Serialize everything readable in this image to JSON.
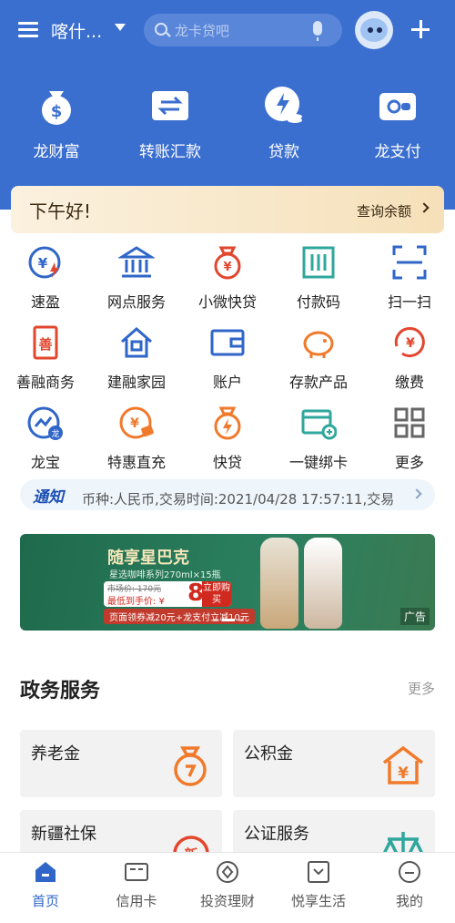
{
  "header": {
    "city": "喀什...",
    "search_placeholder": "龙卡贷吧"
  },
  "quick_actions": [
    {
      "label": "龙财富",
      "icon": "money-bag-icon"
    },
    {
      "label": "转账汇款",
      "icon": "transfer-icon"
    },
    {
      "label": "贷款",
      "icon": "loan-icon"
    },
    {
      "label": "龙支付",
      "icon": "wallet-icon"
    }
  ],
  "greeting": {
    "text": "下午好!",
    "balance_link": "查询余额"
  },
  "services": [
    {
      "label": "速盈",
      "icon": "yen-lightning-icon"
    },
    {
      "label": "网点服务",
      "icon": "bank-building-icon"
    },
    {
      "label": "小微快贷",
      "icon": "yen-bag-icon"
    },
    {
      "label": "付款码",
      "icon": "barcode-icon"
    },
    {
      "label": "扫一扫",
      "icon": "scan-icon"
    },
    {
      "label": "善融商务",
      "icon": "shan-icon"
    },
    {
      "label": "建融家园",
      "icon": "house-icon"
    },
    {
      "label": "账户",
      "icon": "wallet-account-icon"
    },
    {
      "label": "存款产品",
      "icon": "piggy-bank-icon"
    },
    {
      "label": "缴费",
      "icon": "yen-clock-icon"
    },
    {
      "label": "龙宝",
      "icon": "dragon-treasure-icon"
    },
    {
      "label": "特惠直充",
      "icon": "yen-tag-icon"
    },
    {
      "label": "快贷",
      "icon": "money-bag-lightning-icon"
    },
    {
      "label": "一键绑卡",
      "icon": "bind-card-icon"
    },
    {
      "label": "更多",
      "icon": "grid-more-icon"
    }
  ],
  "notice": {
    "tag": "通知",
    "text": "币种:人民币,交易时间:2021/04/28 17:57:11,交易"
  },
  "banner": {
    "title": "随享星巴克",
    "subtitle": "星选咖啡系列270ml×15瓶",
    "original_price": "市场价: 170元",
    "lowest": "最低到手价: ¥",
    "price": "88",
    "buy": "立即购买",
    "promo": "页面领券减20元+龙支付立减10元",
    "ad": "广告"
  },
  "gov": {
    "title": "政务服务",
    "more": "更多",
    "cards": [
      {
        "label": "养老金",
        "icon": "pension-bag-icon"
      },
      {
        "label": "公积金",
        "icon": "yen-house-icon"
      },
      {
        "label": "新疆社保",
        "icon": "social-security-icon"
      },
      {
        "label": "公证服务",
        "icon": "scales-icon"
      }
    ]
  },
  "tabs": [
    {
      "label": "首页",
      "icon": "home-icon",
      "active": true
    },
    {
      "label": "信用卡",
      "icon": "credit-card-icon",
      "active": false
    },
    {
      "label": "投资理财",
      "icon": "invest-icon",
      "active": false
    },
    {
      "label": "悦享生活",
      "icon": "life-icon",
      "active": false
    },
    {
      "label": "我的",
      "icon": "profile-icon",
      "active": false
    }
  ],
  "colors": {
    "brand_blue": "#3b6fcf",
    "accent_red": "#e2462d",
    "accent_orange": "#f07a2b",
    "accent_teal": "#2fa79c"
  }
}
